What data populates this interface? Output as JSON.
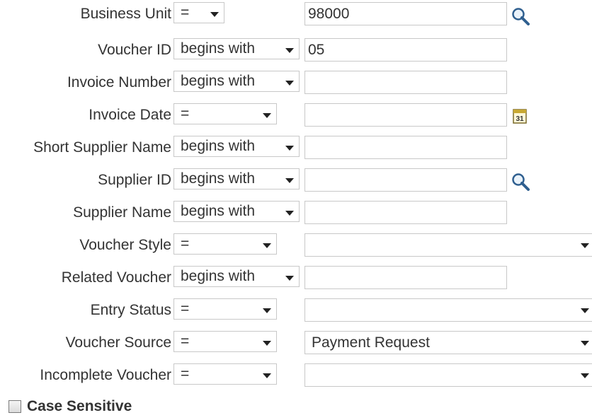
{
  "fields": [
    {
      "label": "Business Unit",
      "operator": "=",
      "value": "98000",
      "kind": "text",
      "icon": "lookup-icon"
    },
    {
      "label": "Voucher ID",
      "operator": "begins with",
      "value": "05",
      "kind": "text",
      "icon": ""
    },
    {
      "label": "Invoice Number",
      "operator": "begins with",
      "value": "",
      "kind": "text",
      "icon": ""
    },
    {
      "label": "Invoice Date",
      "operator": "=",
      "value": "",
      "kind": "text",
      "icon": "calendar-icon",
      "calendar_text": "31"
    },
    {
      "label": "Short Supplier Name",
      "operator": "begins with",
      "value": "",
      "kind": "text",
      "icon": ""
    },
    {
      "label": "Supplier ID",
      "operator": "begins with",
      "value": "",
      "kind": "text",
      "icon": "lookup-icon"
    },
    {
      "label": "Supplier Name",
      "operator": "begins with",
      "value": "",
      "kind": "text",
      "icon": ""
    },
    {
      "label": "Voucher Style",
      "operator": "=",
      "value": "",
      "kind": "select",
      "icon": ""
    },
    {
      "label": "Related Voucher",
      "operator": "begins with",
      "value": "",
      "kind": "text",
      "icon": ""
    },
    {
      "label": "Entry Status",
      "operator": "=",
      "value": "",
      "kind": "select",
      "icon": ""
    },
    {
      "label": "Voucher Source",
      "operator": "=",
      "value": "Payment Request",
      "kind": "select",
      "icon": ""
    },
    {
      "label": "Incomplete Voucher",
      "operator": "=",
      "value": "",
      "kind": "select",
      "icon": ""
    }
  ],
  "case_sensitive": {
    "label": "Case Sensitive",
    "checked": false
  },
  "colors": {
    "border": "#c8c8c8",
    "text": "#333333",
    "lookup_icon": "#3a6ea5"
  }
}
